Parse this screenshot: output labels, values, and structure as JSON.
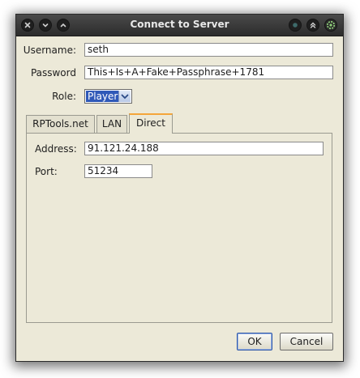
{
  "window": {
    "title": "Connect to Server",
    "titlebar_buttons_left": [
      "close-icon",
      "minimize-icon",
      "maximize-icon"
    ],
    "titlebar_buttons_right": [
      "menu-dot-icon",
      "shade-up-icon",
      "gear-icon"
    ]
  },
  "form": {
    "username_label": "Username:",
    "username_value": "seth",
    "password_label": "Password",
    "password_value": "This+Is+A+Fake+Passphrase+1781",
    "role_label": "Role:",
    "role_value": "Player"
  },
  "tabs": [
    {
      "label": "RPTools.net",
      "active": false
    },
    {
      "label": "LAN",
      "active": false
    },
    {
      "label": "Direct",
      "active": true
    }
  ],
  "direct": {
    "address_label": "Address:",
    "address_value": "91.121.24.188",
    "port_label": "Port:",
    "port_value": "51234"
  },
  "buttons": {
    "ok_label": "OK",
    "cancel_label": "Cancel"
  },
  "colors": {
    "window_bg": "#ece9d8",
    "titlebar_bg": "#2c2c2c",
    "selection": "#2f59b8",
    "active_tab_accent": "#f4a53a"
  }
}
